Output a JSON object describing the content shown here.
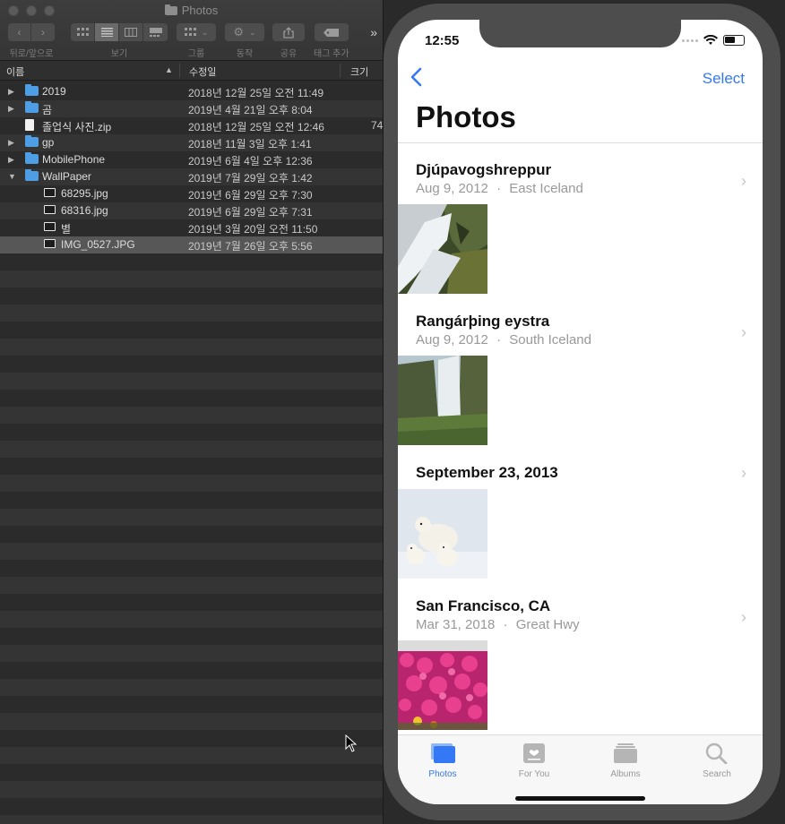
{
  "finder": {
    "window_title": "Photos",
    "toolbar": {
      "back_forward_label": "뒤로/앞으로",
      "view_label": "보기",
      "group_label": "그룹",
      "action_label": "동작",
      "share_label": "공유",
      "tags_label": "태그 추가",
      "more_symbol": "»"
    },
    "columns": {
      "name": "이름",
      "modified": "수정일",
      "size": "크기"
    },
    "files": [
      {
        "name": "2019",
        "date": "2018년 12월 25일 오전 11:49",
        "size": "",
        "type": "folder",
        "disclosure": "collapsed",
        "indent": 0
      },
      {
        "name": "곰",
        "date": "2019년 4월 21일 오후 8:04",
        "size": "",
        "type": "folder",
        "disclosure": "collapsed",
        "indent": 0
      },
      {
        "name": "졸업식 사진.zip",
        "date": "2018년 12월 25일 오전 12:46",
        "size": "74",
        "type": "file",
        "disclosure": "none",
        "indent": 0
      },
      {
        "name": "gp",
        "date": "2018년 11월 3일 오후 1:41",
        "size": "",
        "type": "folder",
        "disclosure": "collapsed",
        "indent": 0
      },
      {
        "name": "MobilePhone",
        "date": "2019년 6월 4일 오후 12:36",
        "size": "",
        "type": "folder",
        "disclosure": "collapsed",
        "indent": 0
      },
      {
        "name": "WallPaper",
        "date": "2019년 7월 29일 오후 1:42",
        "size": "",
        "type": "folder",
        "disclosure": "expanded",
        "indent": 0
      },
      {
        "name": "68295.jpg",
        "date": "2019년 6월 29일 오후 7:30",
        "size": "",
        "type": "image",
        "disclosure": "none",
        "indent": 1
      },
      {
        "name": "68316.jpg",
        "date": "2019년 6월 29일 오후 7:31",
        "size": "",
        "type": "image",
        "disclosure": "none",
        "indent": 1
      },
      {
        "name": "별",
        "date": "2019년 3월 20일 오전 11:50",
        "size": "",
        "type": "image",
        "disclosure": "none",
        "indent": 1
      },
      {
        "name": "IMG_0527.JPG",
        "date": "2019년 7월 26일 오후 5:56",
        "size": "",
        "type": "image",
        "disclosure": "none",
        "indent": 1,
        "selected": true
      }
    ]
  },
  "phone": {
    "status_time": "12:55",
    "nav": {
      "select_label": "Select"
    },
    "title": "Photos",
    "moments": [
      {
        "title": "Djúpavogshreppur",
        "date": "Aug 9, 2012",
        "location": "East Iceland",
        "thumb": "waterfall-rocks"
      },
      {
        "title": "Rangárþing eystra",
        "date": "Aug 9, 2012",
        "location": "South Iceland",
        "thumb": "waterfall-cliff"
      },
      {
        "title": "September 23, 2013",
        "date": "",
        "location": "",
        "thumb": "polar-bears"
      },
      {
        "title": "San Francisco, CA",
        "date": "Mar 31, 2018",
        "location": "Great Hwy",
        "thumb": "pink-flowers"
      }
    ],
    "separator": "·",
    "tabs": [
      {
        "label": "Photos",
        "icon": "photos-icon",
        "active": true
      },
      {
        "label": "For You",
        "icon": "for-you-icon",
        "active": false
      },
      {
        "label": "Albums",
        "icon": "albums-icon",
        "active": false
      },
      {
        "label": "Search",
        "icon": "search-icon",
        "active": false
      }
    ],
    "colors": {
      "accent": "#3478f6",
      "secondary_text": "#999999"
    }
  }
}
